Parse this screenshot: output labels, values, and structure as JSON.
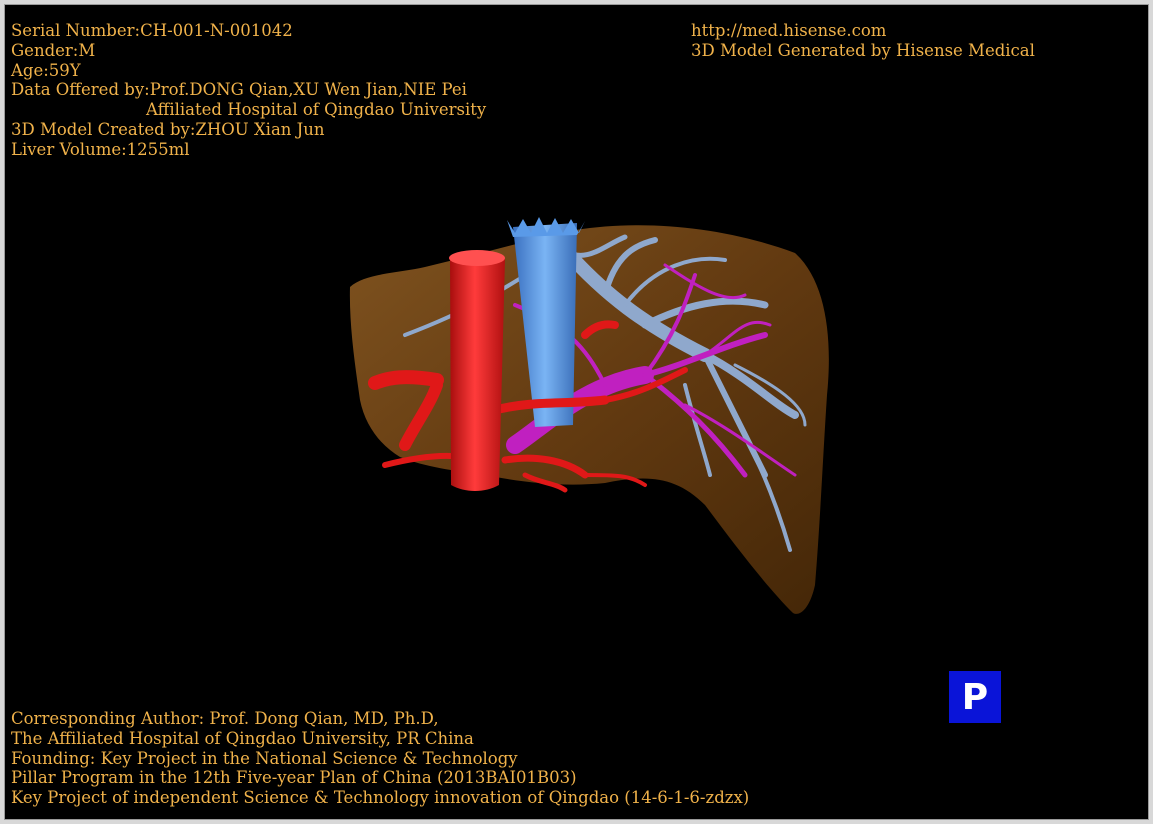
{
  "header_left": {
    "serial": "Serial Number:CH-001-N-001042",
    "gender": "Gender:M",
    "age": "Age:59Y",
    "data_offered": "Data Offered by:Prof.DONG Qian,XU Wen Jian,NIE Pei",
    "hospital": "Affiliated Hospital of Qingdao University",
    "model_created": "3D Model Created by:ZHOU Xian Jun",
    "liver_volume": "Liver Volume:1255ml"
  },
  "header_right": {
    "url": "http://med.hisense.com",
    "generated_by": "3D Model Generated by Hisense Medical"
  },
  "footer": {
    "line1": "Corresponding Author: Prof. Dong Qian, MD, Ph.D,",
    "line2": "The Affiliated Hospital of Qingdao University, PR China",
    "line3": "Founding: Key Project in the National Science & Technology",
    "line4": "Pillar Program in the 12th Five-year Plan of China (2013BAI01B03)",
    "line5": "Key Project of independent Science & Technology innovation of Qingdao (14-6-1-6-zdzx)"
  },
  "p_button_label": "P",
  "colors": {
    "text": "#f0b24a",
    "background": "#000000",
    "liver": "#6b3f12",
    "artery": "#e01818",
    "vena_cava": "#4a8ee0",
    "portal_vein": "#c020c0",
    "hepatic_vein": "#8fa8cc",
    "p_button": "#0a14d8"
  },
  "icons": {
    "model": "liver-3d-model"
  }
}
